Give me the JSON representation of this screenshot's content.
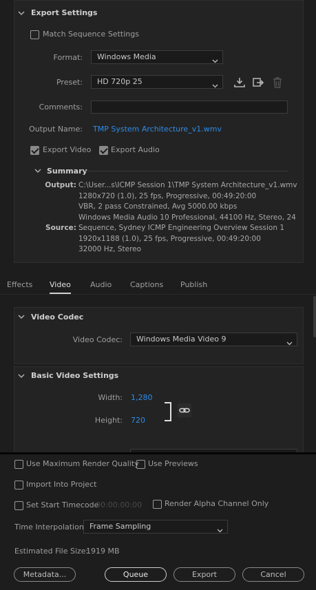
{
  "export_settings": {
    "header": "Export Settings",
    "match_sequence_label": "Match Sequence Settings",
    "format_label": "Format:",
    "format_value": "Windows Media",
    "preset_label": "Preset:",
    "preset_value": "HD 720p 25",
    "comments_label": "Comments:",
    "comments_value": "",
    "output_name_label": "Output Name:",
    "output_name_value": "TMP System Architecture_v1.wmv",
    "export_video_label": "Export Video",
    "export_audio_label": "Export Audio",
    "summary": {
      "header": "Summary",
      "output_label": "Output:",
      "output_lines": [
        "C:\\User...s\\ICMP Session 1\\TMP System Architecture_v1.wmv",
        "1280x720 (1.0), 25 fps, Progressive, 00:49:20:00",
        "VBR, 2 pass Constrained, Avg 5000.00 kbps",
        "Windows Media Audio 10 Professional, 44100 Hz, Stereo, 24 ..."
      ],
      "source_label": "Source:",
      "source_lines": [
        "Sequence, Sydney ICMP Engineering Overview Session 1",
        "1920x1188 (1.0), 25 fps, Progressive, 00:49:20:00",
        "32000 Hz, Stereo"
      ]
    }
  },
  "tabs": [
    {
      "label": "Effects",
      "active": false
    },
    {
      "label": "Video",
      "active": true
    },
    {
      "label": "Audio",
      "active": false
    },
    {
      "label": "Captions",
      "active": false
    },
    {
      "label": "Publish",
      "active": false
    }
  ],
  "video_codec": {
    "header": "Video Codec",
    "codec_label": "Video Codec:",
    "codec_value": "Windows Media Video 9"
  },
  "basic_video": {
    "header": "Basic Video Settings",
    "width_label": "Width:",
    "width_value": "1,280",
    "height_label": "Height:",
    "height_value": "720"
  },
  "bottom": {
    "max_render_quality_label": "Use Maximum Render Quality",
    "use_previews_label": "Use Previews",
    "import_into_project_label": "Import Into Project",
    "set_start_timecode_label": "Set Start Timecode",
    "start_timecode_value": "00:00:00:00",
    "render_alpha_label": "Render Alpha Channel Only",
    "time_interpolation_label": "Time Interpolation:",
    "time_interpolation_value": "Frame Sampling",
    "estimated_file_size_label": "Estimated File Size:",
    "estimated_file_size_value": "1919 MB",
    "buttons": {
      "metadata": "Metadata...",
      "queue": "Queue",
      "export": "Export",
      "cancel": "Cancel"
    }
  }
}
